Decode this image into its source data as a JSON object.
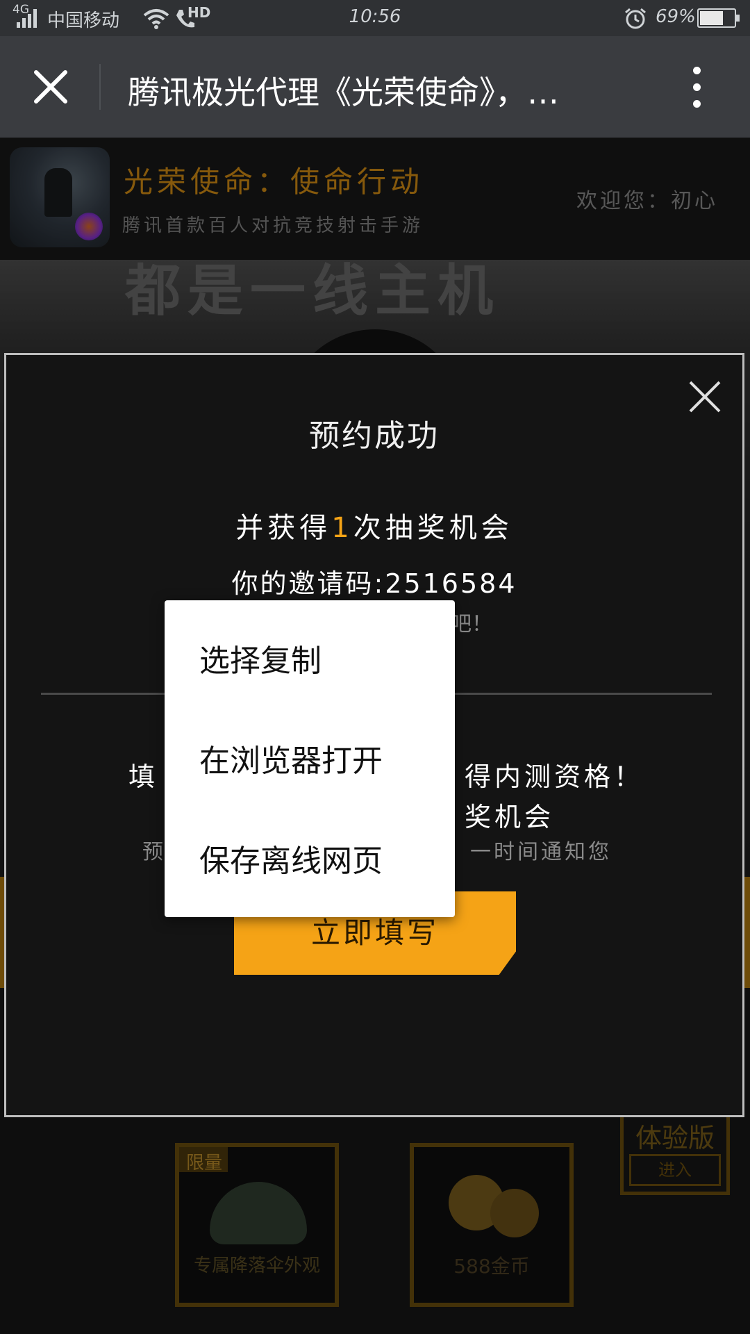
{
  "status_bar": {
    "network": "4G",
    "carrier": "中国移动",
    "hd": "HD",
    "time": "10:56",
    "battery_percent": "69%",
    "battery_level": 0.69
  },
  "title_bar": {
    "title": "腾讯极光代理《光荣使命》，…"
  },
  "site_header": {
    "game_title": "光荣使命：使命行动",
    "game_subtitle": "腾讯首款百人对抗竞技射击手游",
    "welcome": "欢迎您：初心"
  },
  "hero": {
    "banner_text": "都是一线主机"
  },
  "modal": {
    "title": "预约成功",
    "line1_before": "并获得",
    "line1_number": "1",
    "line1_after": "次抽奖机会",
    "invite_label": "你的邀请码:",
    "invite_code": "2516584",
    "hidden_tail": "吧！",
    "phone_line_start": "填",
    "phone_line_end": "得内测资格！",
    "lottery_line_end": "奖机会",
    "notice_start": "预",
    "notice_end": "一时间通知您",
    "fill_button": "立即填写"
  },
  "context_menu": {
    "items": [
      "选择复制",
      "在浏览器打开",
      "保存离线网页"
    ]
  },
  "rewards": {
    "card1_badge": "限量",
    "card1_label": "专属降落伞外观",
    "card2_label": "588金币",
    "trial_label": "体验版",
    "trial_button": "进入"
  },
  "colors": {
    "accent": "#f5a316",
    "status_bar_bg": "#2f3134",
    "title_bar_bg": "#3a3c40"
  }
}
